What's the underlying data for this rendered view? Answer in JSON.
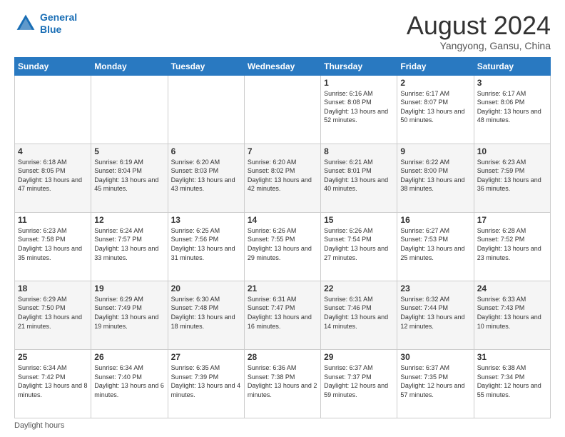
{
  "header": {
    "logo_line1": "General",
    "logo_line2": "Blue",
    "month_title": "August 2024",
    "location": "Yangyong, Gansu, China"
  },
  "days_of_week": [
    "Sunday",
    "Monday",
    "Tuesday",
    "Wednesday",
    "Thursday",
    "Friday",
    "Saturday"
  ],
  "footer": {
    "daylight_label": "Daylight hours"
  },
  "weeks": [
    [
      {
        "day": "",
        "sunrise": "",
        "sunset": "",
        "daylight": ""
      },
      {
        "day": "",
        "sunrise": "",
        "sunset": "",
        "daylight": ""
      },
      {
        "day": "",
        "sunrise": "",
        "sunset": "",
        "daylight": ""
      },
      {
        "day": "",
        "sunrise": "",
        "sunset": "",
        "daylight": ""
      },
      {
        "day": "1",
        "sunrise": "Sunrise: 6:16 AM",
        "sunset": "Sunset: 8:08 PM",
        "daylight": "Daylight: 13 hours and 52 minutes."
      },
      {
        "day": "2",
        "sunrise": "Sunrise: 6:17 AM",
        "sunset": "Sunset: 8:07 PM",
        "daylight": "Daylight: 13 hours and 50 minutes."
      },
      {
        "day": "3",
        "sunrise": "Sunrise: 6:17 AM",
        "sunset": "Sunset: 8:06 PM",
        "daylight": "Daylight: 13 hours and 48 minutes."
      }
    ],
    [
      {
        "day": "4",
        "sunrise": "Sunrise: 6:18 AM",
        "sunset": "Sunset: 8:05 PM",
        "daylight": "Daylight: 13 hours and 47 minutes."
      },
      {
        "day": "5",
        "sunrise": "Sunrise: 6:19 AM",
        "sunset": "Sunset: 8:04 PM",
        "daylight": "Daylight: 13 hours and 45 minutes."
      },
      {
        "day": "6",
        "sunrise": "Sunrise: 6:20 AM",
        "sunset": "Sunset: 8:03 PM",
        "daylight": "Daylight: 13 hours and 43 minutes."
      },
      {
        "day": "7",
        "sunrise": "Sunrise: 6:20 AM",
        "sunset": "Sunset: 8:02 PM",
        "daylight": "Daylight: 13 hours and 42 minutes."
      },
      {
        "day": "8",
        "sunrise": "Sunrise: 6:21 AM",
        "sunset": "Sunset: 8:01 PM",
        "daylight": "Daylight: 13 hours and 40 minutes."
      },
      {
        "day": "9",
        "sunrise": "Sunrise: 6:22 AM",
        "sunset": "Sunset: 8:00 PM",
        "daylight": "Daylight: 13 hours and 38 minutes."
      },
      {
        "day": "10",
        "sunrise": "Sunrise: 6:23 AM",
        "sunset": "Sunset: 7:59 PM",
        "daylight": "Daylight: 13 hours and 36 minutes."
      }
    ],
    [
      {
        "day": "11",
        "sunrise": "Sunrise: 6:23 AM",
        "sunset": "Sunset: 7:58 PM",
        "daylight": "Daylight: 13 hours and 35 minutes."
      },
      {
        "day": "12",
        "sunrise": "Sunrise: 6:24 AM",
        "sunset": "Sunset: 7:57 PM",
        "daylight": "Daylight: 13 hours and 33 minutes."
      },
      {
        "day": "13",
        "sunrise": "Sunrise: 6:25 AM",
        "sunset": "Sunset: 7:56 PM",
        "daylight": "Daylight: 13 hours and 31 minutes."
      },
      {
        "day": "14",
        "sunrise": "Sunrise: 6:26 AM",
        "sunset": "Sunset: 7:55 PM",
        "daylight": "Daylight: 13 hours and 29 minutes."
      },
      {
        "day": "15",
        "sunrise": "Sunrise: 6:26 AM",
        "sunset": "Sunset: 7:54 PM",
        "daylight": "Daylight: 13 hours and 27 minutes."
      },
      {
        "day": "16",
        "sunrise": "Sunrise: 6:27 AM",
        "sunset": "Sunset: 7:53 PM",
        "daylight": "Daylight: 13 hours and 25 minutes."
      },
      {
        "day": "17",
        "sunrise": "Sunrise: 6:28 AM",
        "sunset": "Sunset: 7:52 PM",
        "daylight": "Daylight: 13 hours and 23 minutes."
      }
    ],
    [
      {
        "day": "18",
        "sunrise": "Sunrise: 6:29 AM",
        "sunset": "Sunset: 7:50 PM",
        "daylight": "Daylight: 13 hours and 21 minutes."
      },
      {
        "day": "19",
        "sunrise": "Sunrise: 6:29 AM",
        "sunset": "Sunset: 7:49 PM",
        "daylight": "Daylight: 13 hours and 19 minutes."
      },
      {
        "day": "20",
        "sunrise": "Sunrise: 6:30 AM",
        "sunset": "Sunset: 7:48 PM",
        "daylight": "Daylight: 13 hours and 18 minutes."
      },
      {
        "day": "21",
        "sunrise": "Sunrise: 6:31 AM",
        "sunset": "Sunset: 7:47 PM",
        "daylight": "Daylight: 13 hours and 16 minutes."
      },
      {
        "day": "22",
        "sunrise": "Sunrise: 6:31 AM",
        "sunset": "Sunset: 7:46 PM",
        "daylight": "Daylight: 13 hours and 14 minutes."
      },
      {
        "day": "23",
        "sunrise": "Sunrise: 6:32 AM",
        "sunset": "Sunset: 7:44 PM",
        "daylight": "Daylight: 13 hours and 12 minutes."
      },
      {
        "day": "24",
        "sunrise": "Sunrise: 6:33 AM",
        "sunset": "Sunset: 7:43 PM",
        "daylight": "Daylight: 13 hours and 10 minutes."
      }
    ],
    [
      {
        "day": "25",
        "sunrise": "Sunrise: 6:34 AM",
        "sunset": "Sunset: 7:42 PM",
        "daylight": "Daylight: 13 hours and 8 minutes."
      },
      {
        "day": "26",
        "sunrise": "Sunrise: 6:34 AM",
        "sunset": "Sunset: 7:40 PM",
        "daylight": "Daylight: 13 hours and 6 minutes."
      },
      {
        "day": "27",
        "sunrise": "Sunrise: 6:35 AM",
        "sunset": "Sunset: 7:39 PM",
        "daylight": "Daylight: 13 hours and 4 minutes."
      },
      {
        "day": "28",
        "sunrise": "Sunrise: 6:36 AM",
        "sunset": "Sunset: 7:38 PM",
        "daylight": "Daylight: 13 hours and 2 minutes."
      },
      {
        "day": "29",
        "sunrise": "Sunrise: 6:37 AM",
        "sunset": "Sunset: 7:37 PM",
        "daylight": "Daylight: 12 hours and 59 minutes."
      },
      {
        "day": "30",
        "sunrise": "Sunrise: 6:37 AM",
        "sunset": "Sunset: 7:35 PM",
        "daylight": "Daylight: 12 hours and 57 minutes."
      },
      {
        "day": "31",
        "sunrise": "Sunrise: 6:38 AM",
        "sunset": "Sunset: 7:34 PM",
        "daylight": "Daylight: 12 hours and 55 minutes."
      }
    ]
  ]
}
